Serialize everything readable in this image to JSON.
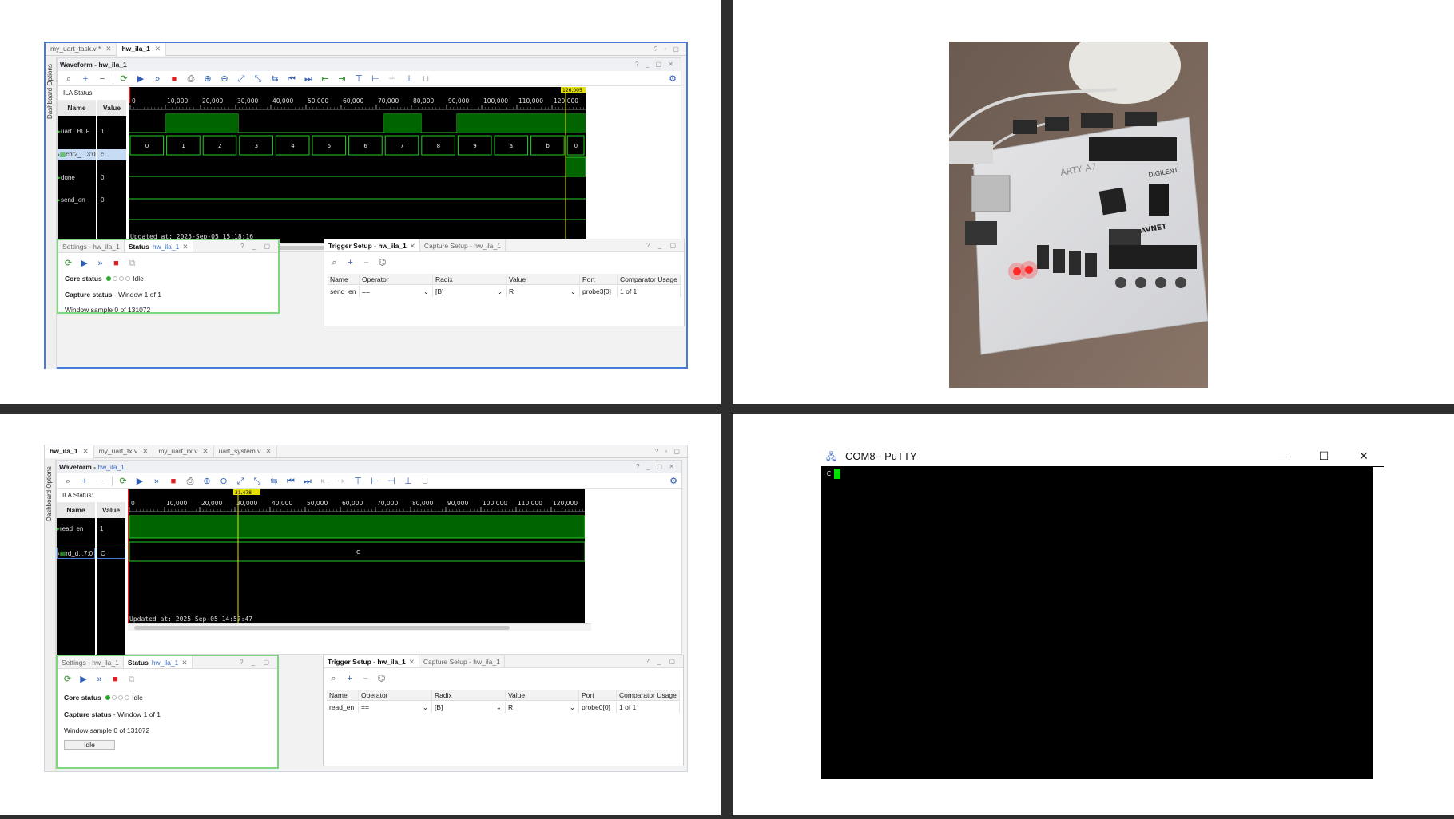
{
  "top_left": {
    "doc_tabs": [
      {
        "label": "my_uart_task.v *",
        "active": false
      },
      {
        "label": "hw_ila_1",
        "active": true
      }
    ],
    "sidebar_label": "Dashboard Options",
    "waveform_title": "Waveform - hw_ila_1",
    "ila_status": "ILA Status: Idle",
    "col_name": "Name",
    "col_value": "Value",
    "signals": [
      {
        "name": "uart...BUF",
        "value": "1"
      },
      {
        "name": "cnt2_...3:0",
        "value": "c"
      },
      {
        "name": "done",
        "value": "0"
      },
      {
        "name": "send_en",
        "value": "0"
      }
    ],
    "axis_ticks": [
      "0",
      "10,000",
      "20,000",
      "30,000",
      "40,000",
      "50,000",
      "60,000",
      "70,000",
      "80,000",
      "90,000",
      "100,000",
      "110,000",
      "120,000",
      "1"
    ],
    "bus_values": [
      "0",
      "1",
      "2",
      "3",
      "4",
      "5",
      "6",
      "7",
      "8",
      "9",
      "a",
      "b",
      "0"
    ],
    "cursor_label": "126,005",
    "updated": "Updated at: 2025-Sep-05 15:18:16",
    "settings_tab": "Settings - hw_ila_1",
    "status_tab": "Status",
    "status_tab_name": "hw_ila_1",
    "core_status_label": "Core status",
    "core_status_value": "Idle",
    "capture_status_label": "Capture status",
    "capture_status_value": "Window 1 of 1",
    "window_sample": "Window sample 0 of 131072",
    "trigger_tab": "Trigger Setup - hw_ila_1",
    "capture_tab": "Capture Setup - hw_ila_1",
    "trigger_headers": [
      "Name",
      "Operator",
      "Radix",
      "Value",
      "Port",
      "Comparator Usage"
    ],
    "trigger_row": {
      "name": "send_en",
      "operator": "==",
      "radix": "[B]",
      "value": "R",
      "port": "probe3[0]",
      "usage": "1 of 1"
    }
  },
  "bottom_left": {
    "doc_tabs": [
      {
        "label": "hw_ila_1",
        "active": true
      },
      {
        "label": "my_uart_tx.v",
        "active": false
      },
      {
        "label": "my_uart_rx.v",
        "active": false
      },
      {
        "label": "uart_system.v",
        "active": false
      }
    ],
    "sidebar_label": "Dashboard Options",
    "waveform_title": "Waveform -",
    "waveform_name": "hw_ila_1",
    "ila_status": "ILA Status: Idle",
    "col_name": "Name",
    "col_value": "Value",
    "signals": [
      {
        "name": "read_en",
        "value": "1"
      },
      {
        "name": "rd_d...7:0",
        "value": "C"
      }
    ],
    "axis_ticks": [
      "0",
      "10,000",
      "20,000",
      "30,000",
      "40,000",
      "50,000",
      "60,000",
      "70,000",
      "80,000",
      "90,000",
      "100,000",
      "110,000",
      "120,000",
      "1"
    ],
    "bus_value": "C",
    "cursor_label": "31,478",
    "updated": "Updated at: 2025-Sep-05 14:57:47",
    "settings_tab": "Settings - hw_ila_1",
    "status_tab": "Status",
    "status_tab_name": "hw_ila_1",
    "core_status_label": "Core status",
    "core_status_value": "Idle",
    "capture_status_label": "Capture status",
    "capture_status_value": "Window 1 of 1",
    "window_sample": "Window sample 0 of 131072",
    "idle_button": "Idle",
    "trigger_tab": "Trigger Setup - hw_ila_1",
    "capture_tab": "Capture Setup - hw_ila_1",
    "trigger_headers": [
      "Name",
      "Operator",
      "Radix",
      "Value",
      "Port",
      "Comparator Usage"
    ],
    "trigger_row": {
      "name": "read_en",
      "operator": "==",
      "radix": "[B]",
      "value": "R",
      "port": "probe0[0]",
      "usage": "1 of 1"
    }
  },
  "photo": {
    "board_brand": "ARTY A7",
    "board_maker": "DIGILENT",
    "board_sponsor": "AVNET"
  },
  "putty": {
    "title": "COM8 - PuTTY",
    "terminal_text": "c"
  },
  "colors": {
    "wave_green": "#006400",
    "wave_edge": "#22d022",
    "cursor_yellow": "#e6e000",
    "panel_green": "#7ed67e",
    "selection_blue": "#4a7ad8"
  }
}
